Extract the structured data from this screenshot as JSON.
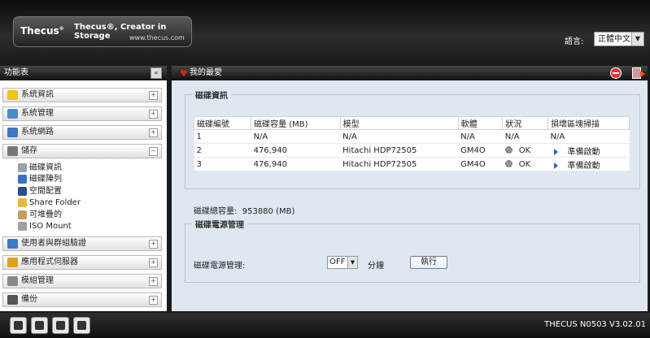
{
  "header": {
    "brand": "Thecus",
    "brand_mark": "®",
    "tagline": "Thecus®, Creator in Storage",
    "site": "www.thecus.com",
    "language_label": "語言:",
    "language_value": "正體中文"
  },
  "sidebar": {
    "title": "功能表",
    "collapse_glyph": "«",
    "menus": [
      {
        "label": "系統資訊",
        "toggle": "+",
        "icon": "info-icon",
        "color": "#f4c20d"
      },
      {
        "label": "系統管理",
        "toggle": "+",
        "icon": "tools-icon",
        "color": "#4a8bd0"
      },
      {
        "label": "系統網路",
        "toggle": "+",
        "icon": "network-icon",
        "color": "#3f76c4"
      },
      {
        "label": "儲存",
        "toggle": "−",
        "icon": "storage-icon",
        "color": "#777777"
      },
      {
        "label": "使用者與群組驗證",
        "toggle": "+",
        "icon": "users-icon",
        "color": "#3c78c8"
      },
      {
        "label": "應用程式伺服器",
        "toggle": "+",
        "icon": "app-server-icon",
        "color": "#e0a020"
      },
      {
        "label": "模組管理",
        "toggle": "+",
        "icon": "module-icon",
        "color": "#888888"
      },
      {
        "label": "備份",
        "toggle": "+",
        "icon": "backup-icon",
        "color": "#555555"
      }
    ],
    "storage_items": [
      {
        "label": "磁碟資訊",
        "icon": "disk-info-icon",
        "color": "#9aa3ad"
      },
      {
        "label": "磁碟陣列",
        "icon": "raid-icon",
        "color": "#3b6fc4"
      },
      {
        "label": "空間配置",
        "icon": "space-allocation-icon",
        "color": "#2b4f8a"
      },
      {
        "label": "Share Folder",
        "icon": "share-folder-icon",
        "color": "#e8b83a"
      },
      {
        "label": "可堆疊的",
        "icon": "stackable-icon",
        "color": "#c0a060"
      },
      {
        "label": "ISO Mount",
        "icon": "iso-mount-icon",
        "color": "#a0a0a0"
      }
    ]
  },
  "main": {
    "title": "我的最愛",
    "disk_info": {
      "legend": "磁碟資訊",
      "columns": [
        "磁碟編號",
        "磁碟容量 (MB)",
        "模型",
        "軟體",
        "狀況",
        "損壞區塊掃描"
      ],
      "rows": [
        {
          "no": "1",
          "capacity": "N/A",
          "model": "N/A",
          "firmware": "N/A",
          "status": "N/A",
          "scan": "N/A",
          "has_icons": false
        },
        {
          "no": "2",
          "capacity": "476,940",
          "model": "Hitachi HDP72505",
          "firmware": "GM4O",
          "status": "OK",
          "scan": "準備啟動",
          "has_icons": true
        },
        {
          "no": "3",
          "capacity": "476,940",
          "model": "Hitachi HDP72505",
          "firmware": "GM4O",
          "status": "OK",
          "scan": "準備啟動",
          "has_icons": true
        }
      ],
      "total_label": "磁碟總容量:",
      "total_value": "953880 (MB)"
    },
    "power": {
      "legend": "磁碟電源管理",
      "label": "磁碟電源管理:",
      "select_value": "OFF",
      "unit": "分鐘",
      "button": "執行"
    }
  },
  "footer": {
    "version": "THECUS N0503 V3.02.01",
    "buttons": [
      "system-log-icon",
      "disk-icon",
      "tools-icon",
      "network-icon"
    ]
  }
}
